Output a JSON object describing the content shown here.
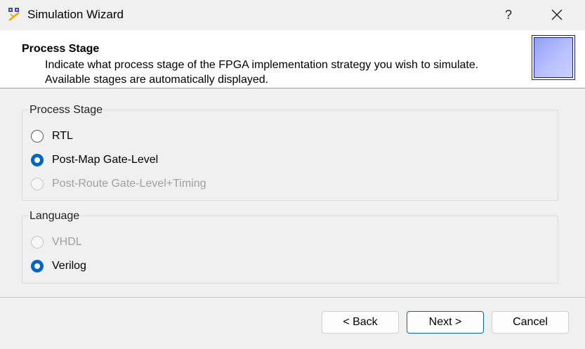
{
  "window": {
    "title": "Simulation Wizard",
    "help_label": "?",
    "app_icon": "wizard-wand-icon",
    "close_icon": "close-icon"
  },
  "header": {
    "title": "Process Stage",
    "description_line1": "Indicate what process stage of the FPGA implementation strategy you wish to simulate.",
    "description_line2": "Available stages are automatically displayed."
  },
  "process_stage": {
    "label": "Process Stage",
    "options": [
      {
        "label": "RTL",
        "checked": false,
        "enabled": true
      },
      {
        "label": "Post-Map Gate-Level",
        "checked": true,
        "enabled": true
      },
      {
        "label": "Post-Route Gate-Level+Timing",
        "checked": false,
        "enabled": false
      }
    ]
  },
  "language": {
    "label": "Language",
    "options": [
      {
        "label": "VHDL",
        "checked": false,
        "enabled": false
      },
      {
        "label": "Verilog",
        "checked": true,
        "enabled": true
      }
    ]
  },
  "buttons": {
    "back": "< Back",
    "next": "Next >",
    "cancel": "Cancel"
  },
  "colors": {
    "accent": "#0067c0",
    "disabled_text": "#a0a0a0"
  }
}
